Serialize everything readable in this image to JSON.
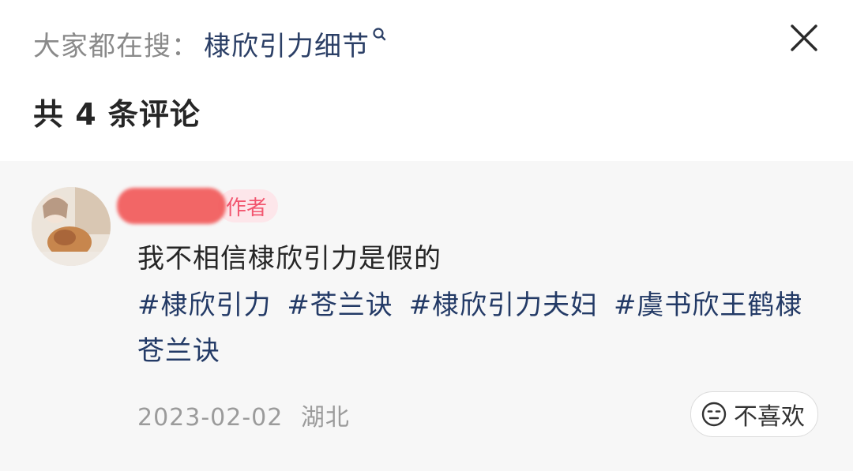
{
  "search": {
    "prefix": "大家都在搜：",
    "keyword": "棣欣引力细节"
  },
  "comment_count_title": "共 4 条评论",
  "comment": {
    "author_badge": "作者",
    "text": "我不相信棣欣引力是假的",
    "hashtags": [
      "#棣欣引力",
      "#苍兰诀",
      "#棣欣引力夫妇",
      "#虞书欣王鹤棣苍兰诀"
    ],
    "date": "2023-02-02",
    "location": "湖北",
    "dislike_label": "不喜欢"
  },
  "colors": {
    "keyword": "#2b3f66",
    "hashtag": "#233a66",
    "author_badge_text": "#f2566f",
    "author_badge_bg": "#fde6ea",
    "comment_area_bg": "#f7f7f7"
  },
  "icons": {
    "close": "close-icon",
    "search": "search-icon",
    "dislike": "unamused-face-icon"
  }
}
